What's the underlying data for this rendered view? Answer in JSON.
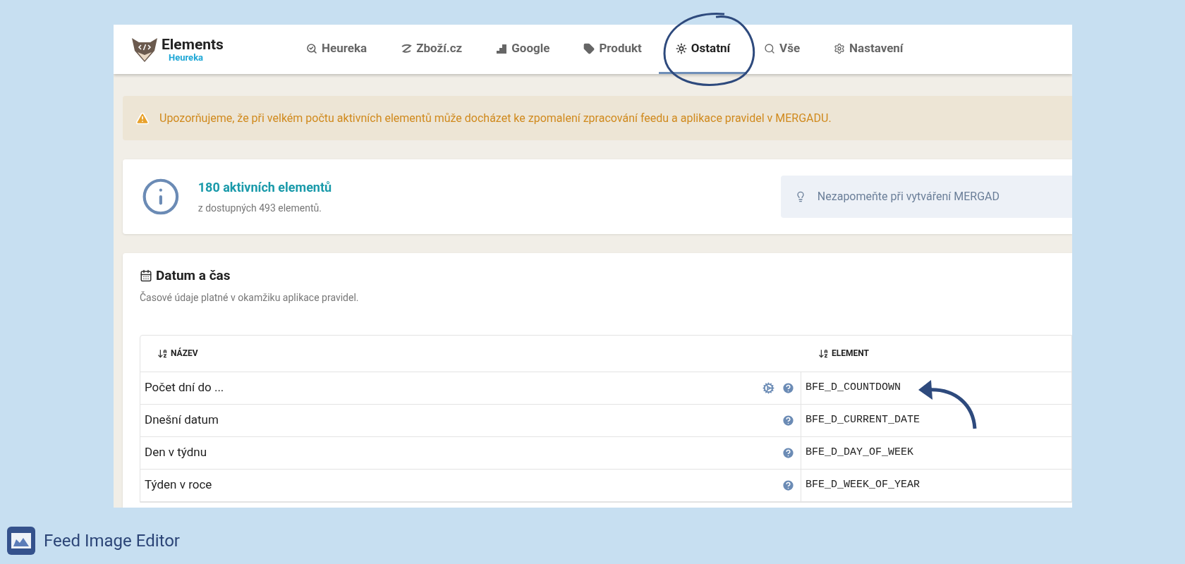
{
  "app": {
    "logo_title": "Elements",
    "logo_subtitle": "Heureka"
  },
  "tabs": [
    {
      "label": "Heureka",
      "selected": false
    },
    {
      "label": "Zboží.cz",
      "selected": false
    },
    {
      "label": "Google",
      "selected": false
    },
    {
      "label": "Produkt",
      "selected": false
    },
    {
      "label": "Ostatní",
      "selected": true
    },
    {
      "label": "Vše",
      "selected": false
    },
    {
      "label": "Nastavení",
      "selected": false
    }
  ],
  "warning": "Upozorňujeme, že při velkém počtu aktivních elementů může docházet ke zpomalení zpracování feedu a aplikace pravidel v MERGADU.",
  "summary": {
    "title": "180 aktivních elementů",
    "subtitle": "z dostupných 493 elementů.",
    "tip": "Nezapomeňte při vytváření MERGAD"
  },
  "section": {
    "title": "Datum a čas",
    "description": "Časové údaje platné v okamžiku aplikace pravidel.",
    "columns": [
      "NÁZEV",
      "ELEMENT"
    ],
    "rows": [
      {
        "name": "Počet dní do ...",
        "settings": true,
        "element": "BFE_D_COUNTDOWN"
      },
      {
        "name": "Dnešní datum",
        "settings": false,
        "element": "BFE_D_CURRENT_DATE"
      },
      {
        "name": "Den v týdnu",
        "settings": false,
        "element": "BFE_D_DAY_OF_WEEK"
      },
      {
        "name": "Týden v roce",
        "settings": false,
        "element": "BFE_D_WEEK_OF_YEAR"
      }
    ]
  },
  "brand": {
    "label": "Feed Image Editor"
  }
}
